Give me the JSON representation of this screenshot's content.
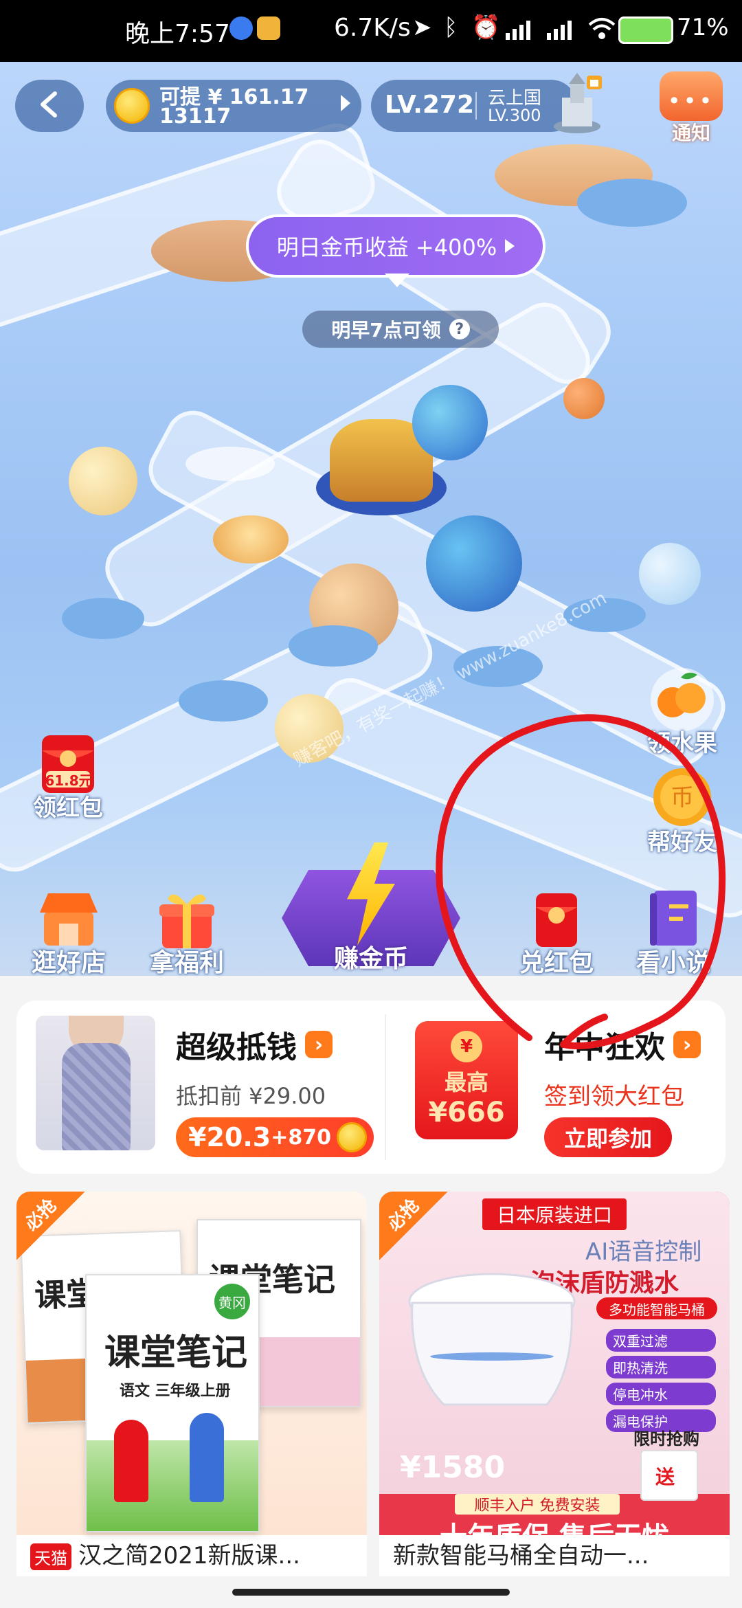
{
  "status_bar": {
    "time": "晚上7:57",
    "speed": "6.7K/s",
    "battery": "71%"
  },
  "header": {
    "coin_line1": "可提 ¥ 161.17",
    "coin_line2": "13117",
    "level": "LV.272",
    "city": "云上国",
    "city_level": "LV.300",
    "notice": "通知",
    "notice_dots": "•••"
  },
  "scene": {
    "bonus": "明日金币收益 +400%",
    "claim_hint": "明早7点可领",
    "claim_help": "?",
    "watermark": "赚客吧，有奖一起赚！ www.zuanke8.com",
    "redpacket_amount": "61.8元"
  },
  "side_buttons": {
    "left": [
      {
        "label": "领红包"
      }
    ],
    "right": [
      {
        "label": "领水果"
      },
      {
        "label": "帮好友"
      }
    ]
  },
  "bottom_buttons": [
    {
      "label": "逛好店"
    },
    {
      "label": "拿福利"
    },
    {
      "label": "赚金币"
    },
    {
      "label": "兑红包"
    },
    {
      "label": "看小说"
    }
  ],
  "promo": {
    "left": {
      "title": "超级抵钱",
      "arrow": "›",
      "was": "抵扣前 ¥29.00",
      "price": "¥20.3",
      "coins": "+870"
    },
    "right": {
      "title": "年中狂欢",
      "arrow": "›",
      "seal": "¥",
      "pack_label": "最高",
      "pack_amount": "¥666",
      "subtitle": "签到领大红包",
      "button": "立即参加"
    }
  },
  "products": [
    {
      "badge": "必抢",
      "store_tag": "天猫",
      "title": "汉之简2021新版课...",
      "book_title": "课堂笔记",
      "book_sub": "语文 三年级上册",
      "book_tag": "黄冈"
    },
    {
      "badge": "必抢",
      "title": "新款智能马桶全自动一...",
      "banner_top": "日本原装进口",
      "feature1": "AI语音控制",
      "feature2": "泡沫盾防溅水",
      "feature_tag": "多功能智能马桶",
      "features": [
        "双重过滤",
        "即热清洗",
        "停电冲水",
        "漏电保护"
      ],
      "flash": "限时抢购",
      "gift": "送",
      "price": "¥1580",
      "delivery": "顺丰入户 免费安装",
      "warranty": "十年质保 售后无忧"
    }
  ],
  "colors": {
    "accent": "#ff7a1b",
    "red": "#e5161b",
    "purple": "#8c63ef",
    "sky": "#a8cbf7"
  }
}
